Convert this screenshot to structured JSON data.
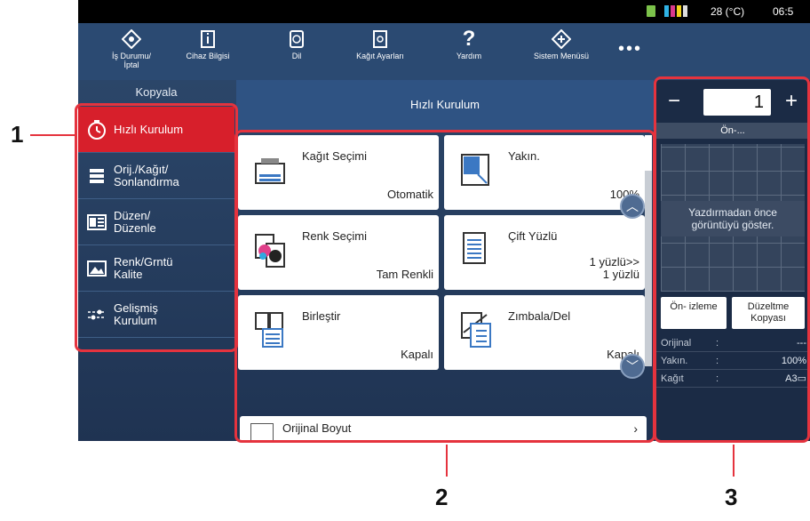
{
  "status": {
    "temperature": "28 (°C)",
    "time": "06:5"
  },
  "toolbar": {
    "job_status": "İş Durumu/\nİptal",
    "device_info": "Cihaz Bilgisi",
    "language": "Dil",
    "paper_settings": "Kağıt Ayarları",
    "help": "Yardım",
    "system_menu": "Sistem Menüsü",
    "more": "•••"
  },
  "sidebar": {
    "title": "Kopyala",
    "items": [
      {
        "label": "Hızlı Kurulum",
        "icon": "stopwatch-icon"
      },
      {
        "label": "Orij./Kağıt/\nSonlandırma",
        "icon": "document-lines-icon"
      },
      {
        "label": "Düzen/\nDüzenle",
        "icon": "layout-icon"
      },
      {
        "label": "Renk/Grntü\nKalite",
        "icon": "image-icon"
      },
      {
        "label": "Gelişmiş\nKurulum",
        "icon": "sliders-icon"
      }
    ]
  },
  "main": {
    "title": "Hızlı Kurulum",
    "tiles": [
      {
        "label": "Kağıt Seçimi",
        "value": "Otomatik",
        "icon": "paper-tray-icon"
      },
      {
        "label": "Yakın.",
        "value": "100%",
        "icon": "zoom-icon"
      },
      {
        "label": "Renk Seçimi",
        "value": "Tam Renkli",
        "icon": "color-select-icon"
      },
      {
        "label": "Çift Yüzlü",
        "value": "1 yüzlü>>\n1 yüzlü",
        "icon": "duplex-icon"
      },
      {
        "label": "Birleştir",
        "value": "Kapalı",
        "icon": "combine-icon"
      },
      {
        "label": "Zımbala/Del",
        "value": "Kapalı",
        "icon": "staple-punch-icon"
      }
    ],
    "original_size": "Orijinal Boyut"
  },
  "right_panel": {
    "copies": "1",
    "minus": "−",
    "plus": "+",
    "preview_header": "Ön-...",
    "preview_message": "Yazdırmadan önce\ngörüntüyü göster.",
    "preview_button": "Ön-\nizleme",
    "correct_copy_button": "Düzeltme\nKopyası",
    "info": [
      {
        "key": "Orijinal",
        "sep": ":",
        "value": "---"
      },
      {
        "key": "Yakın.",
        "sep": ":",
        "value": "100%"
      },
      {
        "key": "Kağıt",
        "sep": ":",
        "value": "A3▭"
      }
    ]
  },
  "callouts": {
    "one": "1",
    "two": "2",
    "three": "3"
  },
  "colors": {
    "accent_red": "#d71f2b",
    "callout_red": "#e5333e",
    "panel_blue": "#2b4a72"
  }
}
